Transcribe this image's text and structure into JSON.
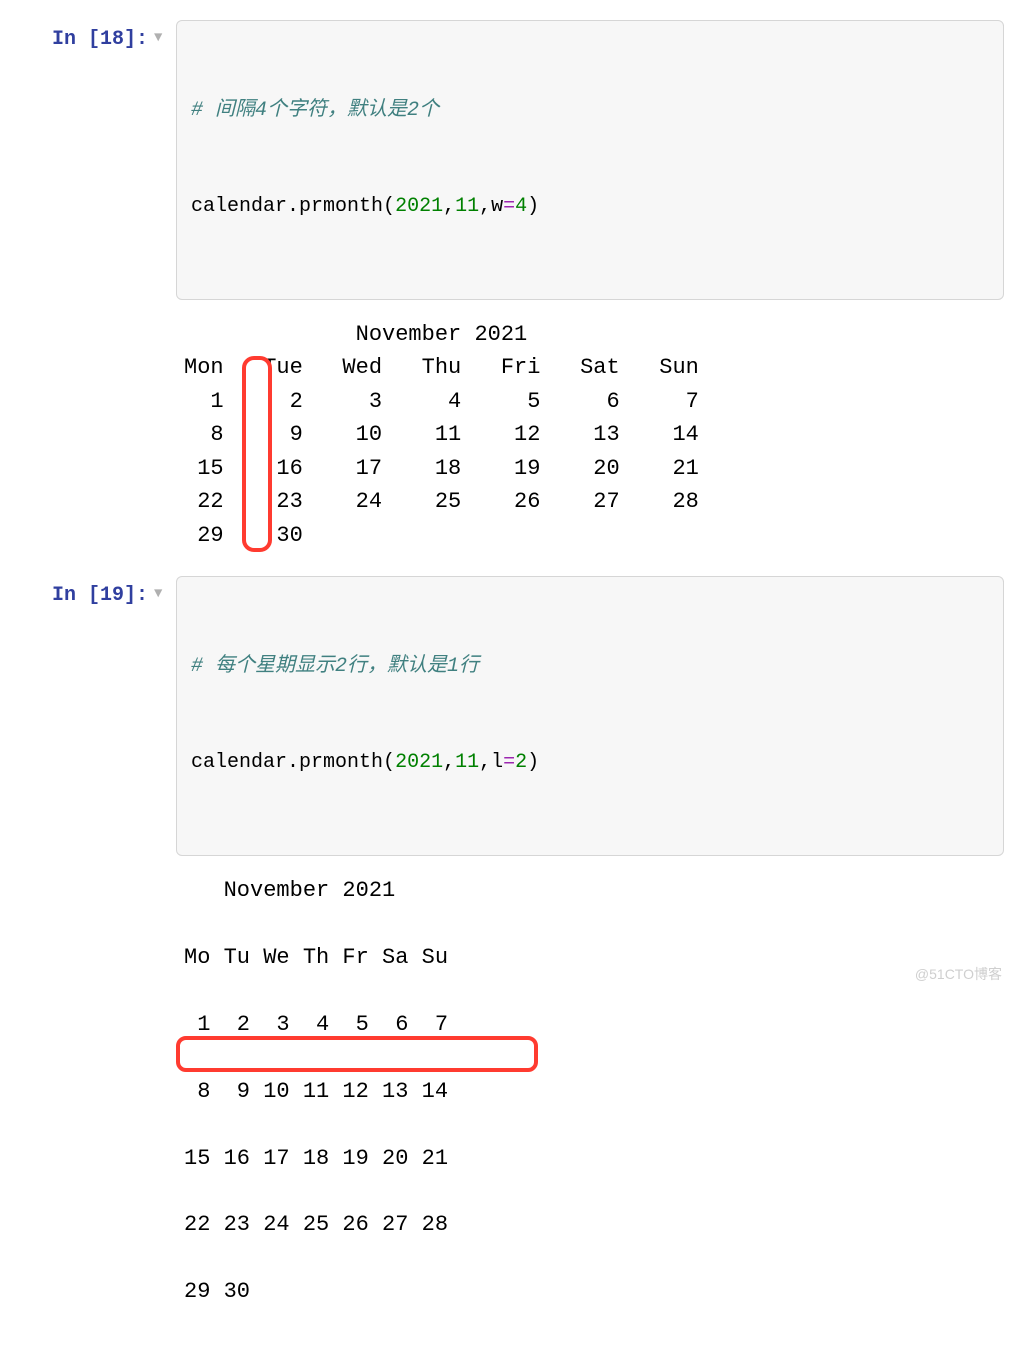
{
  "cells": {
    "c18": {
      "prompt": "In [18]:",
      "comment": "# 间隔4个字符，默认是2个",
      "code": {
        "obj": "calendar",
        "dot": ".",
        "fn": "prmonth",
        "lp": "(",
        "arg1": "2021",
        "comma1": ",",
        "arg2": "11",
        "comma2": ",",
        "kw": "w",
        "eq": "=",
        "arg3": "4",
        "rp": ")"
      },
      "output": "             November 2021\nMon   Tue   Wed   Thu   Fri   Sat   Sun\n  1     2     3     4     5     6     7\n  8     9    10    11    12    13    14\n 15    16    17    18    19    20    21\n 22    23    24    25    26    27    28\n 29    30"
    },
    "c19": {
      "prompt": "In [19]:",
      "comment": "# 每个星期显示2行，默认是1行",
      "code": {
        "obj": "calendar",
        "dot": ".",
        "fn": "prmonth",
        "lp": "(",
        "arg1": "2021",
        "comma1": ",",
        "arg2": "11",
        "comma2": ",",
        "kw": "l",
        "eq": "=",
        "arg3": "2",
        "rp": ")"
      },
      "output": "   November 2021\n\nMo Tu We Th Fr Sa Su\n\n 1  2  3  4  5  6  7\n\n 8  9 10 11 12 13 14\n\n15 16 17 18 19 20 21\n\n22 23 24 25 26 27 28\n\n29 30\n"
    }
  },
  "watermark": "@51CTO博客",
  "annotation_colors": {
    "highlight": "#ff3b30"
  }
}
